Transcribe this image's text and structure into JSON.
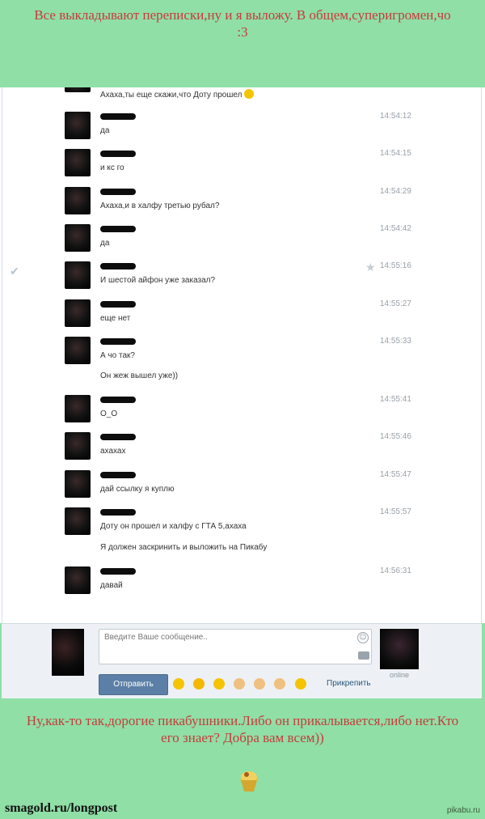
{
  "top_caption": "Все выкладывают переписки,ну и я выложу. В общем,суперигромен,чо :3",
  "messages": [
    {
      "time": "",
      "lines": [
        "Ахаха,ты еще скажи,что Доту прошел"
      ],
      "emoji": "laughing-emoji-icon"
    },
    {
      "time": "14:54:12",
      "lines": [
        "да"
      ]
    },
    {
      "time": "14:54:15",
      "lines": [
        "и кс го"
      ]
    },
    {
      "time": "14:54:29",
      "lines": [
        "Ахаха,и в халфу третью рубал?"
      ]
    },
    {
      "time": "14:54:42",
      "lines": [
        "да"
      ]
    },
    {
      "time": "14:55:16",
      "lines": [
        "И шестой айфон уже заказал?"
      ],
      "selected": true
    },
    {
      "time": "14:55:27",
      "lines": [
        "еще нет"
      ]
    },
    {
      "time": "14:55:33",
      "lines": [
        "А чо так?",
        "Он жеж вышел уже))"
      ]
    },
    {
      "time": "14:55:41",
      "lines": [
        "О_О"
      ]
    },
    {
      "time": "14:55:46",
      "lines": [
        "ахахах"
      ]
    },
    {
      "time": "14:55:47",
      "lines": [
        "дай ссылку я куплю"
      ]
    },
    {
      "time": "14:55:57",
      "lines": [
        "Доту он прошел и халфу с ГТА 5,ахаха",
        "Я должен заскринить и выложить на Пикабу"
      ]
    },
    {
      "time": "14:56:31",
      "lines": [
        "давай"
      ]
    }
  ],
  "composer": {
    "placeholder": "Введите Ваше сообщение..",
    "send_label": "Отправить",
    "attach_label": "Прикрепить",
    "online_label": "online"
  },
  "bottom_caption": "Ну,как-то так,дорогие пикабушники.Либо он прикалывается,либо нет.Кто его знает? Добра вам всем))",
  "footer_link": "smagold.ru/longpost",
  "watermark": "pikabu.ru",
  "colors": {
    "caption": "#c83b3b",
    "background": "#8fdfa6",
    "send_button": "#5b7fa6"
  }
}
